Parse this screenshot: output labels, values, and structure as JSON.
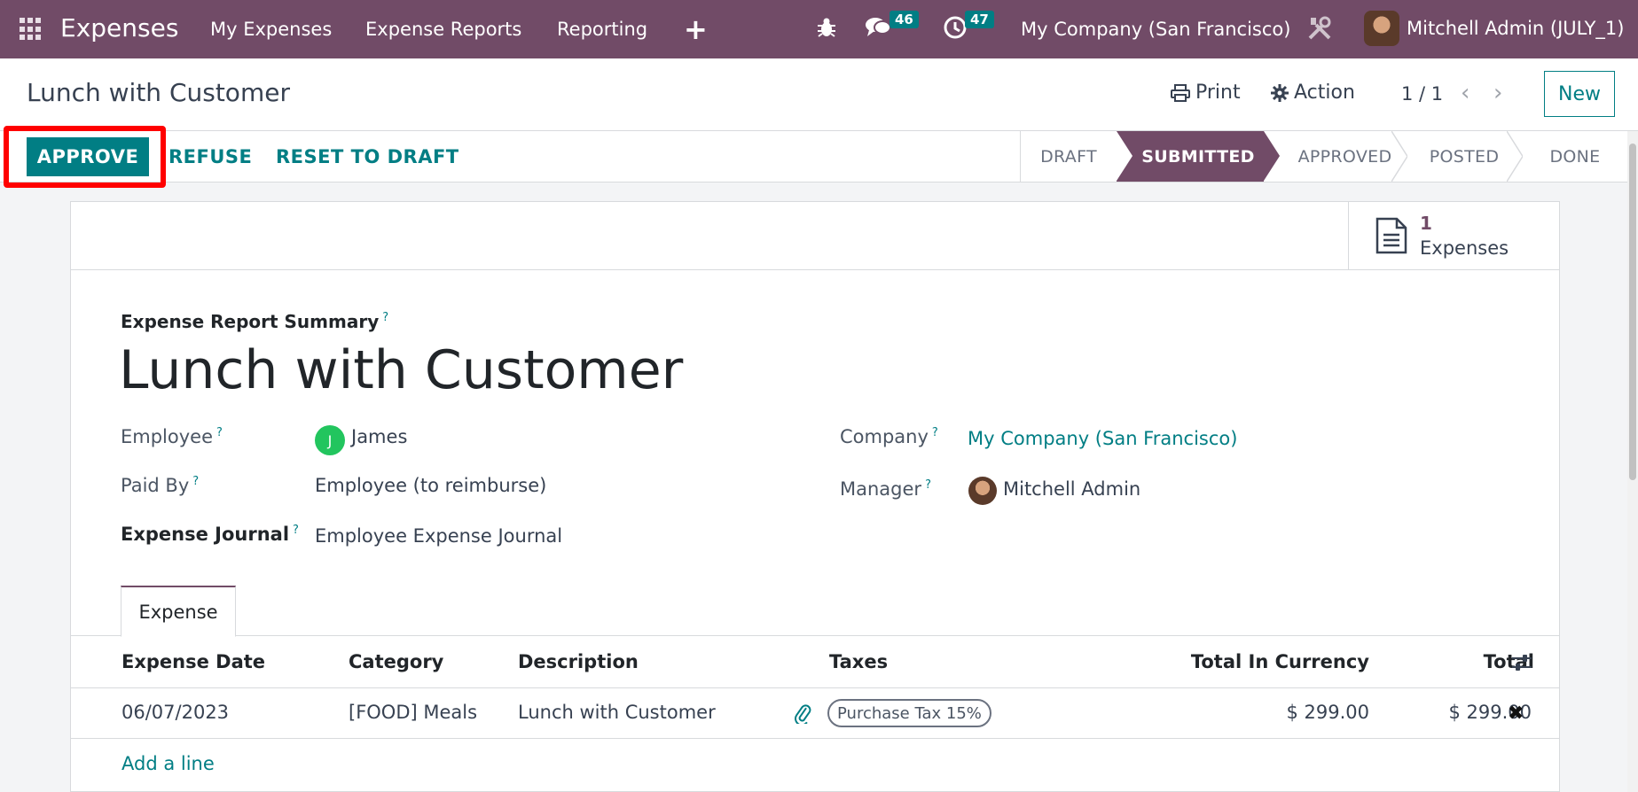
{
  "navbar": {
    "app_name": "Expenses",
    "menu": [
      "My Expenses",
      "Expense Reports",
      "Reporting"
    ],
    "plus_label": "+",
    "messages_count": "46",
    "activities_count": "47",
    "company": "My Company (San Francisco)",
    "user": "Mitchell Admin (JULY_1)"
  },
  "control_panel": {
    "breadcrumb": "Lunch with Customer",
    "print_label": "Print",
    "action_label": "Action",
    "pager": "1 / 1",
    "new_label": "New"
  },
  "statusbar": {
    "approve_label": "APPROVE",
    "refuse_label": "REFUSE",
    "reset_label": "RESET TO DRAFT",
    "stages": [
      "DRAFT",
      "SUBMITTED",
      "APPROVED",
      "POSTED",
      "DONE"
    ],
    "active_stage": "SUBMITTED"
  },
  "stat_button": {
    "value": "1",
    "label": "Expenses"
  },
  "form": {
    "summary_label": "Expense Report Summary",
    "help_mark": "?",
    "title": "Lunch with Customer",
    "employee_label": "Employee",
    "employee_initial": "J",
    "employee_value": "James",
    "paid_by_label": "Paid By",
    "paid_by_value": "Employee (to reimburse)",
    "journal_label": "Expense Journal",
    "journal_value": "Employee Expense Journal",
    "company_label": "Company",
    "company_value": "My Company (San Francisco)",
    "manager_label": "Manager",
    "manager_value": "Mitchell Admin"
  },
  "tabs": [
    "Expense"
  ],
  "table": {
    "headers": [
      "Expense Date",
      "Category",
      "Description",
      "Taxes",
      "Total In Currency",
      "Total"
    ],
    "rows": [
      {
        "date": "06/07/2023",
        "category": "[FOOD] Meals",
        "description": "Lunch with Customer",
        "tax": "Purchase Tax 15%",
        "total_currency": "$ 299.00",
        "total": "$ 299.00"
      }
    ],
    "add_line": "Add a line"
  },
  "colors": {
    "brand": "#714b67",
    "accent": "#017e84",
    "highlight": "#ff0000"
  }
}
